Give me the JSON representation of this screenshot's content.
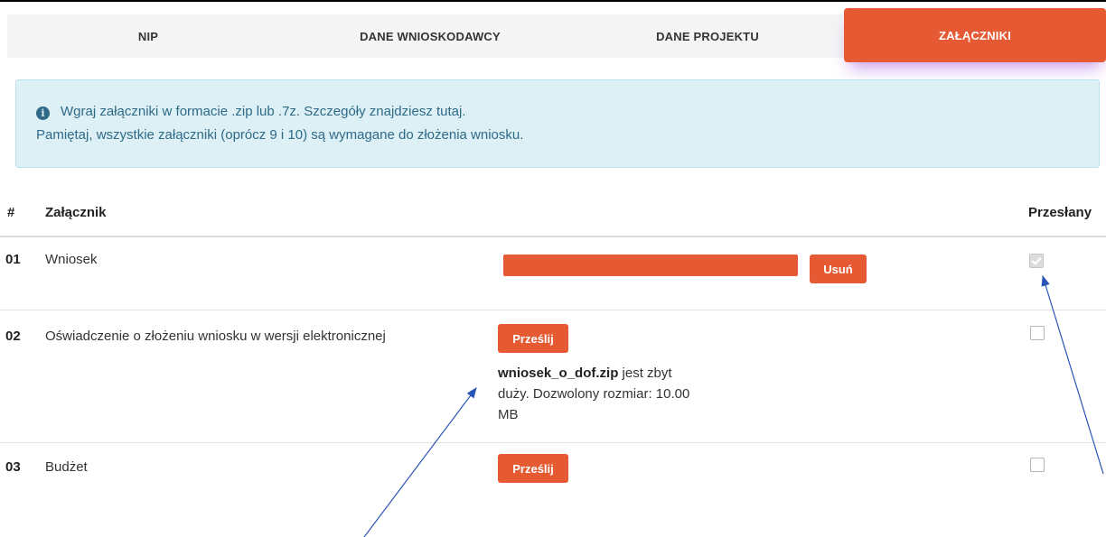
{
  "tabs": {
    "nip": "NIP",
    "dane_wnioskodawcy": "DANE WNIOSKODAWCY",
    "dane_projektu": "DANE PROJEKTU",
    "zalaczniki": "ZAŁĄCZNIKI"
  },
  "info": {
    "icon": "info-circle-icon",
    "line1": "Wgraj załączniki w formacie .zip lub .7z. Szczegóły znajdziesz tutaj.",
    "line2": "Pamiętaj, wszystkie załączniki (oprócz 9 i 10) są wymagane do złożenia wniosku."
  },
  "table": {
    "headers": {
      "num": "#",
      "attachment": "Załącznik",
      "sent": "Przesłany"
    },
    "rows": [
      {
        "num": "01",
        "name": "Wniosek",
        "action": "Usuń",
        "sent": true
      },
      {
        "num": "02",
        "name": "Oświadczenie o złożeniu wniosku w wersji elektronicznej",
        "action": "Prześlij",
        "sent": false,
        "error": {
          "filename": "wniosek_o_dof.zip",
          "line1_rest": " jest zbyt",
          "line2": "duży. Dozwolony rozmiar: 10.00",
          "line3": "MB"
        }
      },
      {
        "num": "03",
        "name": "Budżet",
        "action": "Prześlij",
        "sent": false
      }
    ]
  },
  "colors": {
    "accent": "#e65a33",
    "info_bg": "#dcf0f6",
    "info_text": "#2f6a86",
    "annotation_arrow": "#2a55b8"
  }
}
